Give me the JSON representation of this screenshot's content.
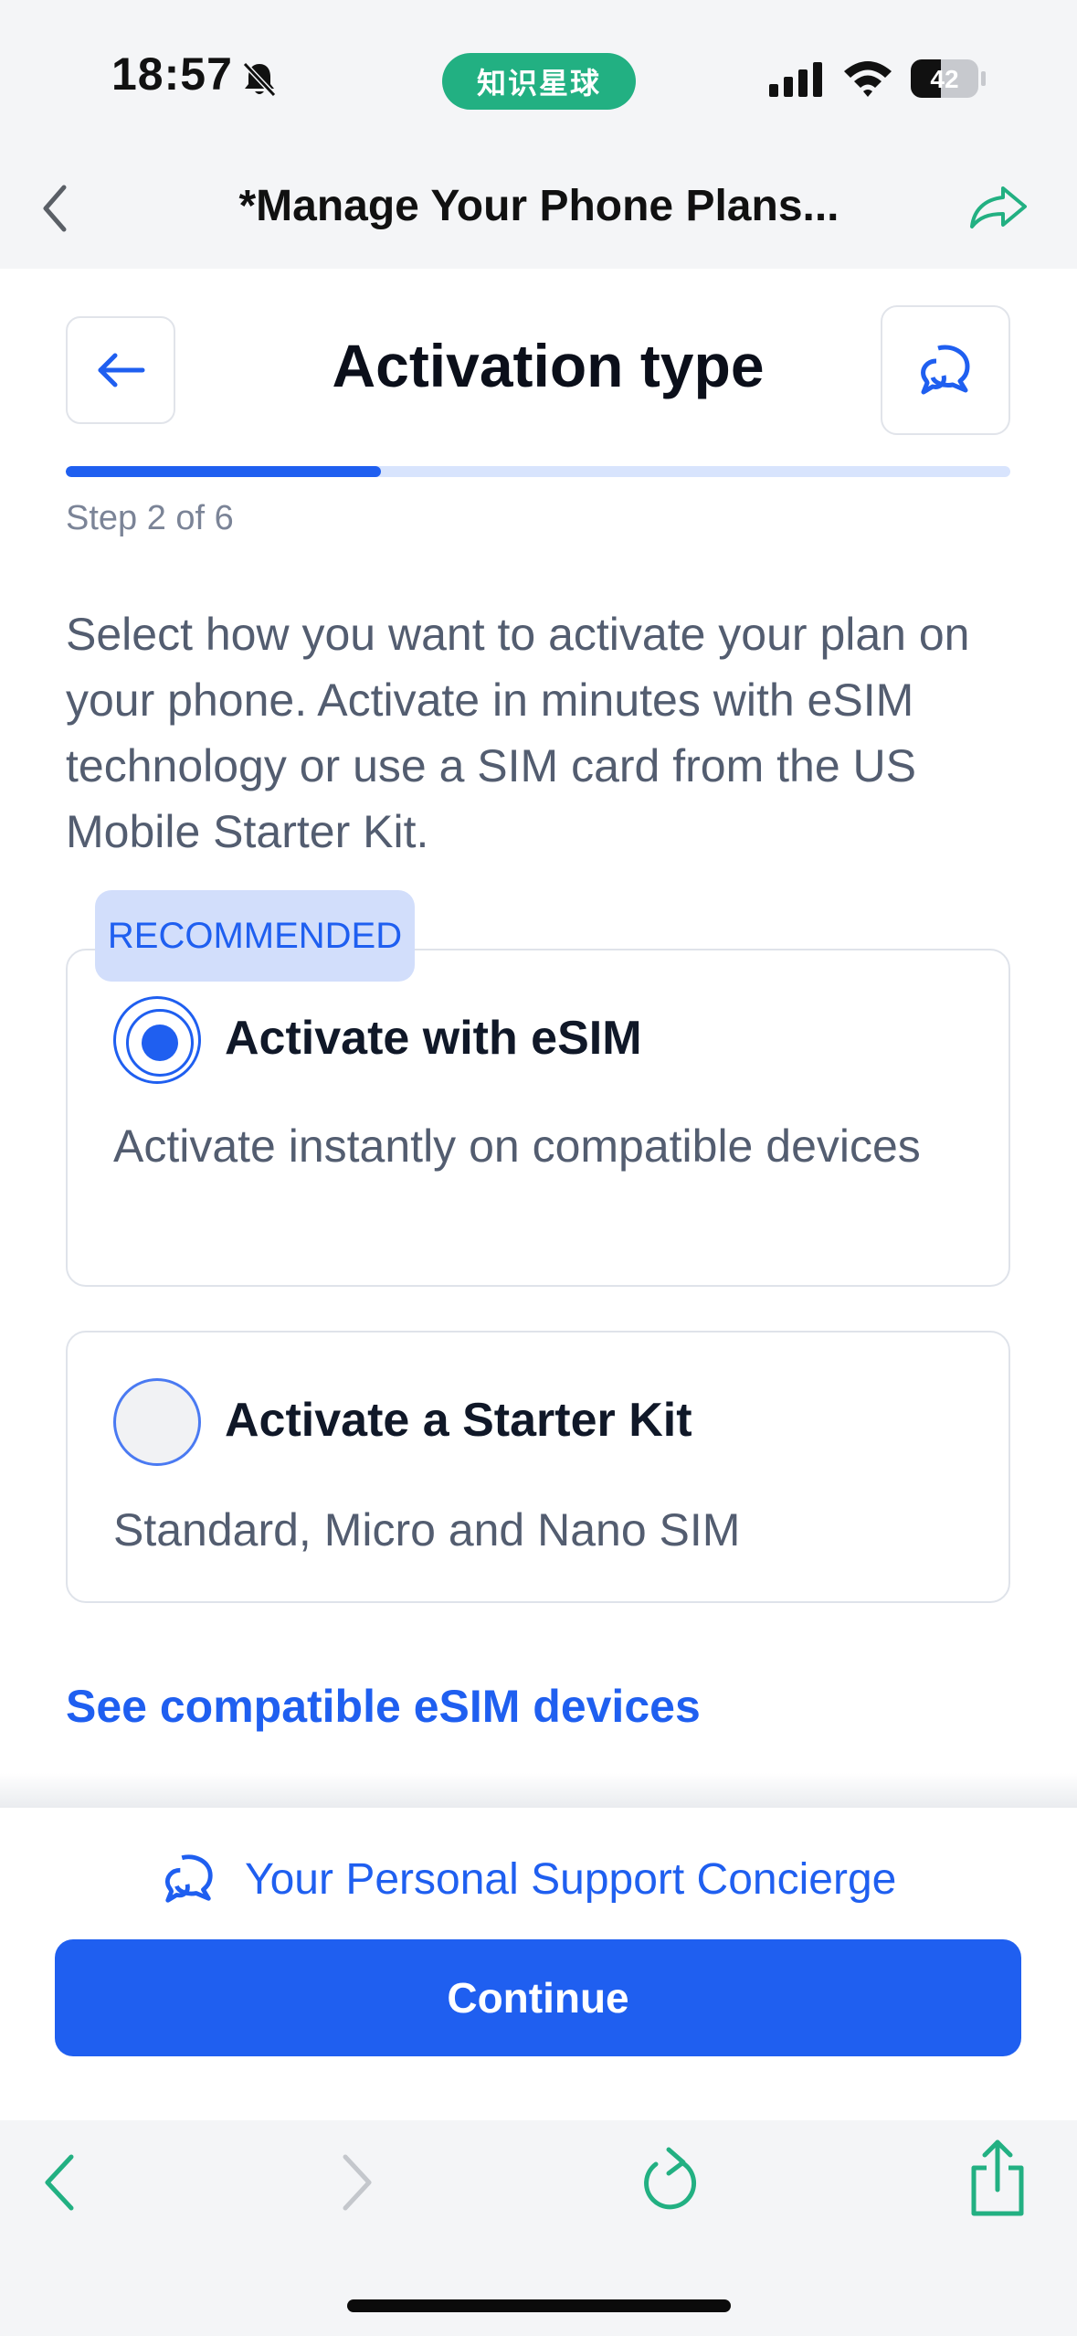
{
  "status_bar": {
    "time": "18:57",
    "app_badge": "知识星球",
    "battery": "42",
    "icons": [
      "bell-slash-icon",
      "signal-icon",
      "wifi-icon",
      "battery-icon"
    ]
  },
  "browser": {
    "title": "*Manage Your Phone Plans...",
    "icons": [
      "chevron-left-icon",
      "share-arrow-icon"
    ]
  },
  "page": {
    "title": "Activation type",
    "step": {
      "label": "Step 2 of 6",
      "current": 2,
      "total": 6
    },
    "intro": "Select how you want to activate your plan on your phone. Activate in minutes with eSIM technology or use a SIM card from the US Mobile Starter Kit.",
    "options": [
      {
        "badge": "RECOMMENDED",
        "title": "Activate with eSIM",
        "description": "Activate instantly on compatible devices",
        "selected": true
      },
      {
        "title": "Activate a Starter Kit",
        "description": "Standard, Micro and Nano SIM",
        "selected": false
      }
    ],
    "compat_link": "See compatible eSIM devices",
    "concierge_label": "Your Personal Support Concierge",
    "continue_label": "Continue"
  },
  "colors": {
    "accent": "#1f5ff0",
    "accent_light": "#d8e4fd",
    "badge_bg": "#d2defb",
    "browser_accent": "#22b082",
    "text_primary": "#101828",
    "text_secondary": "#535d70"
  },
  "toolbar": {
    "icons": [
      "back-icon",
      "forward-icon",
      "reload-icon",
      "share-icon"
    ]
  }
}
